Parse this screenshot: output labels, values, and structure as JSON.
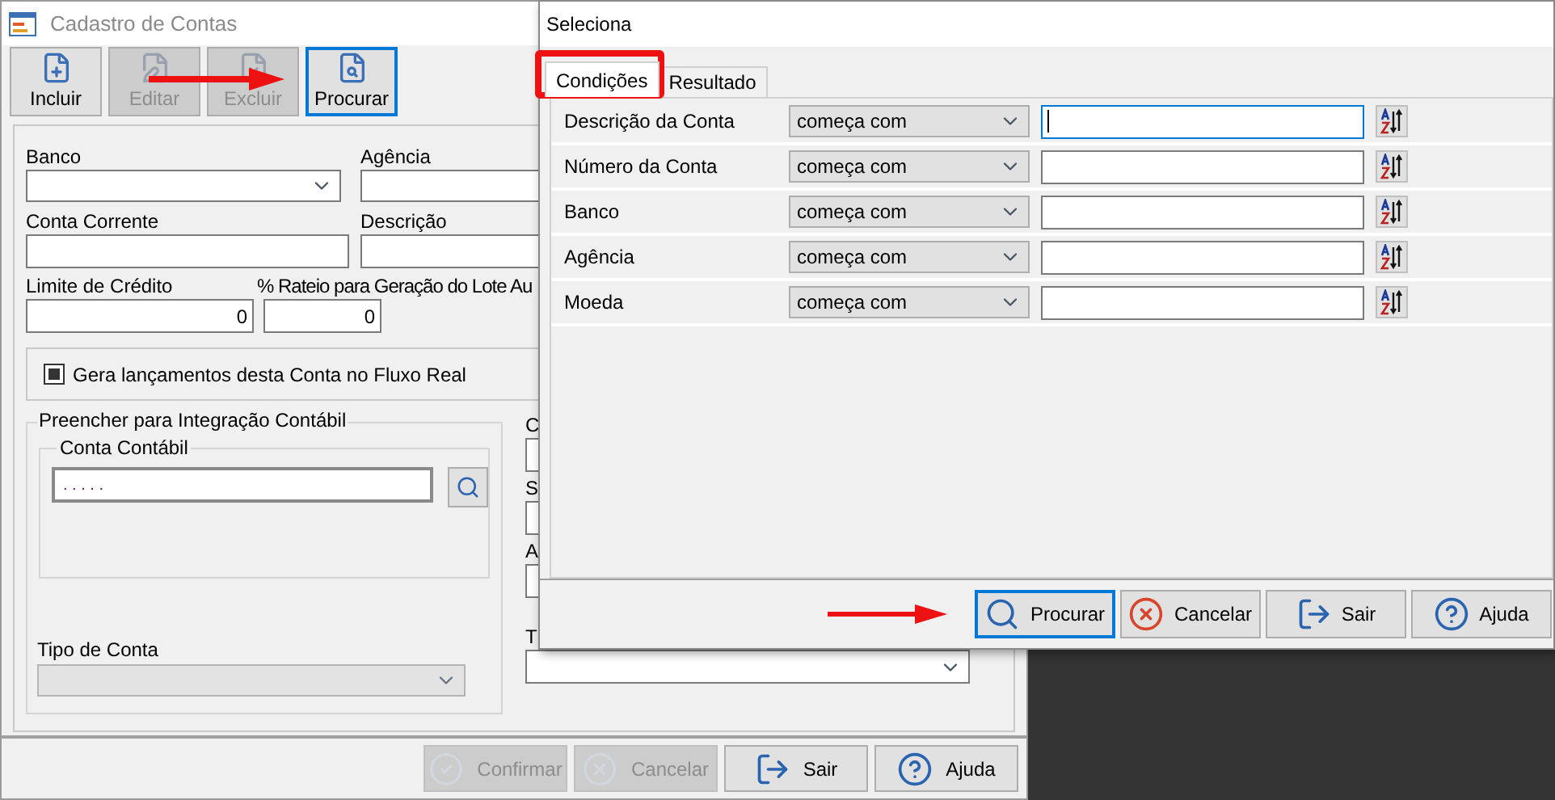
{
  "main_window": {
    "title": "Cadastro de Contas",
    "active": false,
    "toolbar": [
      {
        "label": "Incluir",
        "kind": "new",
        "disabled": false,
        "focused": false
      },
      {
        "label": "Editar",
        "kind": "edit",
        "disabled": true,
        "focused": false
      },
      {
        "label": "Excluir",
        "kind": "delete",
        "disabled": true,
        "focused": false
      },
      {
        "label": "Procurar",
        "kind": "find",
        "disabled": false,
        "focused": true
      }
    ],
    "form": {
      "banco_label": "Banco",
      "agencia_label": "Agência",
      "conta_corrente_label": "Conta Corrente",
      "descricao_label": "Descrição",
      "limite_label": "Limite de Crédito",
      "limite_value": "0",
      "rateio_label": "% Rateio para Geração do Lote Au",
      "rateio_value": "0",
      "fluxo_real": {
        "label": "Gera lançamentos desta Conta no Fluxo Real",
        "checked": true
      },
      "integracao": {
        "title": "Preencher para Integração Contábil",
        "conta_contabil_title": "Conta Contábil",
        "conta_contabil_value": ". . . . ."
      },
      "column_2_labels": [
        "C",
        "S",
        "A",
        "T"
      ],
      "tipo_conta": {
        "label": "Tipo de Conta",
        "disabled": true
      }
    },
    "footer_buttons": [
      {
        "label": "Confirmar",
        "kind": "check",
        "disabled": true
      },
      {
        "label": "Cancelar",
        "kind": "cancel",
        "disabled": true
      },
      {
        "label": "Sair",
        "kind": "exit",
        "disabled": false
      },
      {
        "label": "Ajuda",
        "kind": "help",
        "disabled": false
      }
    ]
  },
  "dialog": {
    "title": "Seleciona",
    "tabs": [
      {
        "label": "Condições",
        "selected": true
      },
      {
        "label": "Resultado",
        "selected": false
      }
    ],
    "conditions": [
      {
        "field": "Descrição da Conta",
        "operator": "começa com",
        "focused": true
      },
      {
        "field": "Número da Conta",
        "operator": "começa com",
        "focused": false
      },
      {
        "field": "Banco",
        "operator": "começa com",
        "focused": false
      },
      {
        "field": "Agência",
        "operator": "começa com",
        "focused": false
      },
      {
        "field": "Moeda",
        "operator": "começa com",
        "focused": false
      }
    ],
    "buttons": [
      {
        "label": "Procurar",
        "kind": "search",
        "focused": true
      },
      {
        "label": "Cancelar",
        "kind": "cancel",
        "focused": false
      },
      {
        "label": "Sair",
        "kind": "exit",
        "focused": false
      },
      {
        "label": "Ajuda",
        "kind": "help",
        "focused": false
      }
    ]
  }
}
